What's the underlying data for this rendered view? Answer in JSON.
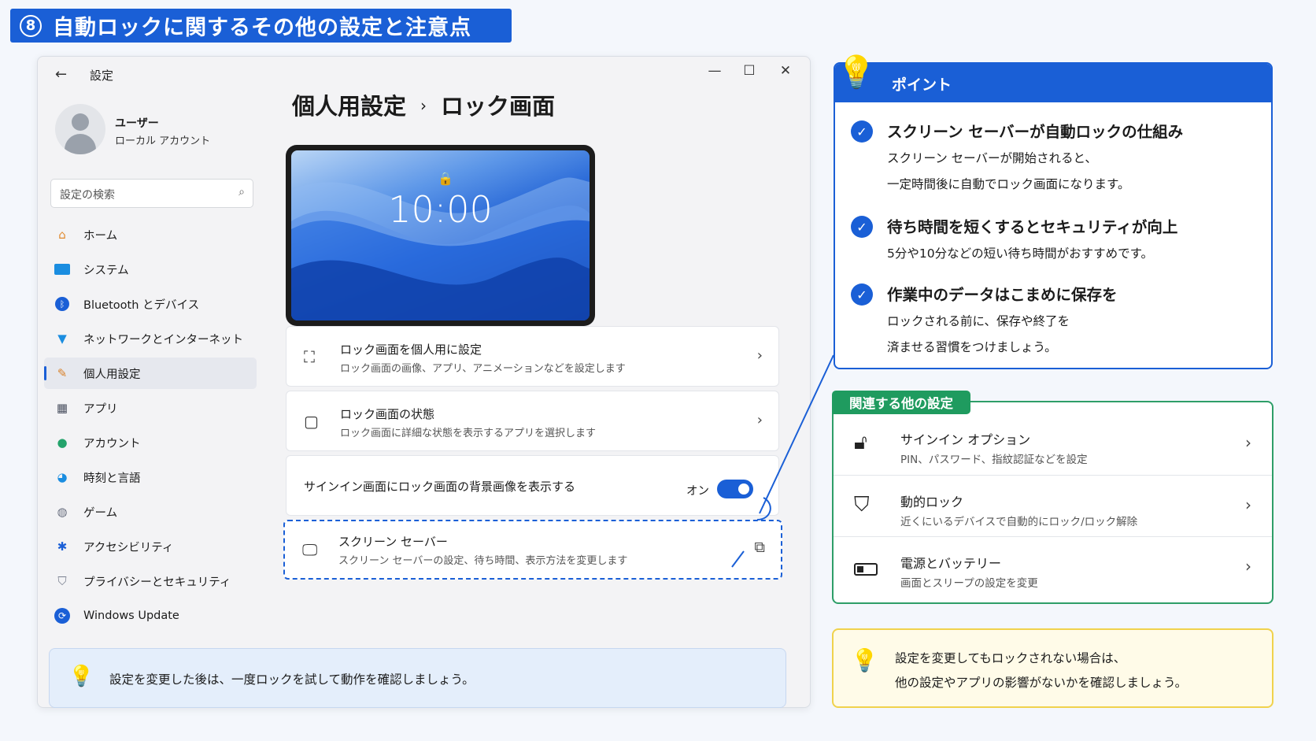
{
  "banner": {
    "number": "8",
    "title": "自動ロックに関するその他の設定と注意点"
  },
  "window": {
    "title": "設定",
    "controls": {
      "minimize": "—",
      "maximize": "☐",
      "close": "✕"
    },
    "user": {
      "name": "ユーザー",
      "account": "ローカル アカウント"
    },
    "search_placeholder": "設定の検索",
    "nav": [
      {
        "label": "ホーム",
        "icon": "home-icon"
      },
      {
        "label": "システム",
        "icon": "system-icon"
      },
      {
        "label": "Bluetooth とデバイス",
        "icon": "bluetooth-icon"
      },
      {
        "label": "ネットワークとインターネット",
        "icon": "wifi-icon"
      },
      {
        "label": "個人用設定",
        "icon": "brush-icon",
        "active": true
      },
      {
        "label": "アプリ",
        "icon": "apps-icon"
      },
      {
        "label": "アカウント",
        "icon": "account-icon"
      },
      {
        "label": "時刻と言語",
        "icon": "globe-icon"
      },
      {
        "label": "ゲーム",
        "icon": "gamepad-icon"
      },
      {
        "label": "アクセシビリティ",
        "icon": "accessibility-icon"
      },
      {
        "label": "プライバシーとセキュリティ",
        "icon": "shield-icon"
      },
      {
        "label": "Windows Update",
        "icon": "update-icon"
      }
    ],
    "breadcrumb": {
      "parent": "個人用設定",
      "separator": "›",
      "current": "ロック画面"
    },
    "preview_time": "10:00",
    "cards": [
      {
        "title": "ロック画面を個人用に設定",
        "subtitle": "ロック画面の画像、アプリ、アニメーションなどを設定します"
      },
      {
        "title": "ロック画面の状態",
        "subtitle": "ロック画面に詳細な状態を表示するアプリを選択します"
      }
    ],
    "toggle_row": {
      "label": "サインイン画面にロック画面の背景画像を表示する",
      "state": "オン",
      "on": true
    },
    "screensaver": {
      "title": "スクリーン セーバー",
      "subtitle": "スクリーン セーバーの設定、待ち時間、表示方法を変更します"
    },
    "tip": "設定を変更した後は、一度ロックを試して動作を確認しましょう。"
  },
  "points": {
    "heading": "ポイント",
    "items": [
      {
        "title": "スクリーン セーバーが自動ロックの仕組み",
        "lines": [
          "スクリーン セーバーが開始されると、",
          "一定時間後に自動でロック画面になります。"
        ]
      },
      {
        "title": "待ち時間を短くするとセキュリティが向上",
        "lines": [
          "5分や10分などの短い待ち時間がおすすめです。"
        ]
      },
      {
        "title": "作業中のデータはこまめに保存を",
        "lines": [
          "ロックされる前に、保存や終了を",
          "済ませる習慣をつけましょう。"
        ]
      }
    ]
  },
  "related": {
    "tag": "関連する他の設定",
    "rows": [
      {
        "title": "サインイン オプション",
        "subtitle": "PIN、パスワード、指紋認証などを設定"
      },
      {
        "title": "動的ロック",
        "subtitle": "近くにいるデバイスで自動的にロック/ロック解除"
      },
      {
        "title": "電源とバッテリー",
        "subtitle": "画面とスリープの設定を変更"
      }
    ]
  },
  "note": {
    "line1": "設定を変更してもロックされない場合は、",
    "line2": "他の設定やアプリの影響がないかを確認しましょう。"
  },
  "colors": {
    "accent": "#1a5fd6",
    "green": "#1f9b5f",
    "yellow_border": "#f0d24c"
  }
}
